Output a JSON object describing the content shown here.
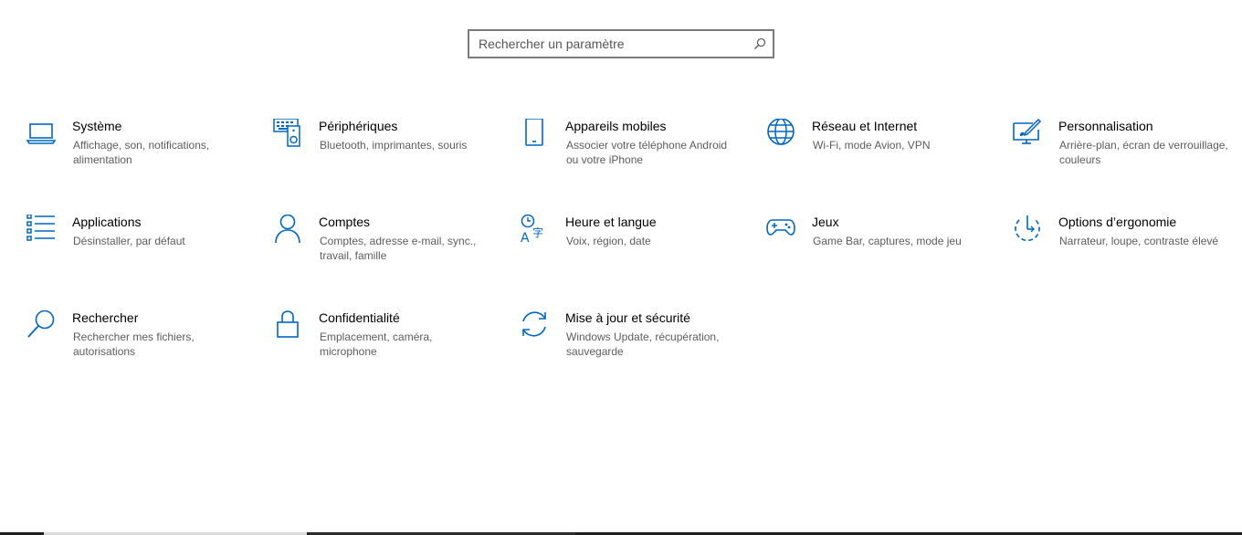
{
  "search": {
    "placeholder": "Rechercher un paramètre",
    "icon": "search-icon"
  },
  "accent_color": "#0067c0",
  "tiles": [
    {
      "title": "Système",
      "desc": "Affichage, son, notifications, alimentation",
      "icon": "laptop-icon"
    },
    {
      "title": "Périphériques",
      "desc": "Bluetooth, imprimantes, souris",
      "icon": "devices-icon"
    },
    {
      "title": "Appareils mobiles",
      "desc": "Associer votre téléphone Android ou votre iPhone",
      "icon": "phone-icon"
    },
    {
      "title": "Réseau et Internet",
      "desc": "Wi-Fi, mode Avion, VPN",
      "icon": "globe-icon"
    },
    {
      "title": "Personnalisation",
      "desc": "Arrière-plan, écran de verrouillage, couleurs",
      "icon": "paint-icon"
    },
    {
      "title": "Applications",
      "desc": "Désinstaller, par défaut",
      "icon": "apps-list-icon"
    },
    {
      "title": "Comptes",
      "desc": "Comptes, adresse e-mail, sync., travail, famille",
      "icon": "person-icon"
    },
    {
      "title": "Heure et langue",
      "desc": "Voix, région, date",
      "icon": "time-language-icon"
    },
    {
      "title": "Jeux",
      "desc": "Game Bar, captures, mode jeu",
      "icon": "gamepad-icon"
    },
    {
      "title": "Options d’ergonomie",
      "desc": "Narrateur, loupe, contraste élevé",
      "icon": "ease-of-access-icon"
    },
    {
      "title": "Rechercher",
      "desc": "Rechercher mes fichiers, autorisations",
      "icon": "magnifier-icon"
    },
    {
      "title": "Confidentialité",
      "desc": "Emplacement, caméra, microphone",
      "icon": "lock-icon"
    },
    {
      "title": "Mise à jour et sécurité",
      "desc": "Windows Update, récupération, sauvegarde",
      "icon": "update-icon"
    }
  ]
}
